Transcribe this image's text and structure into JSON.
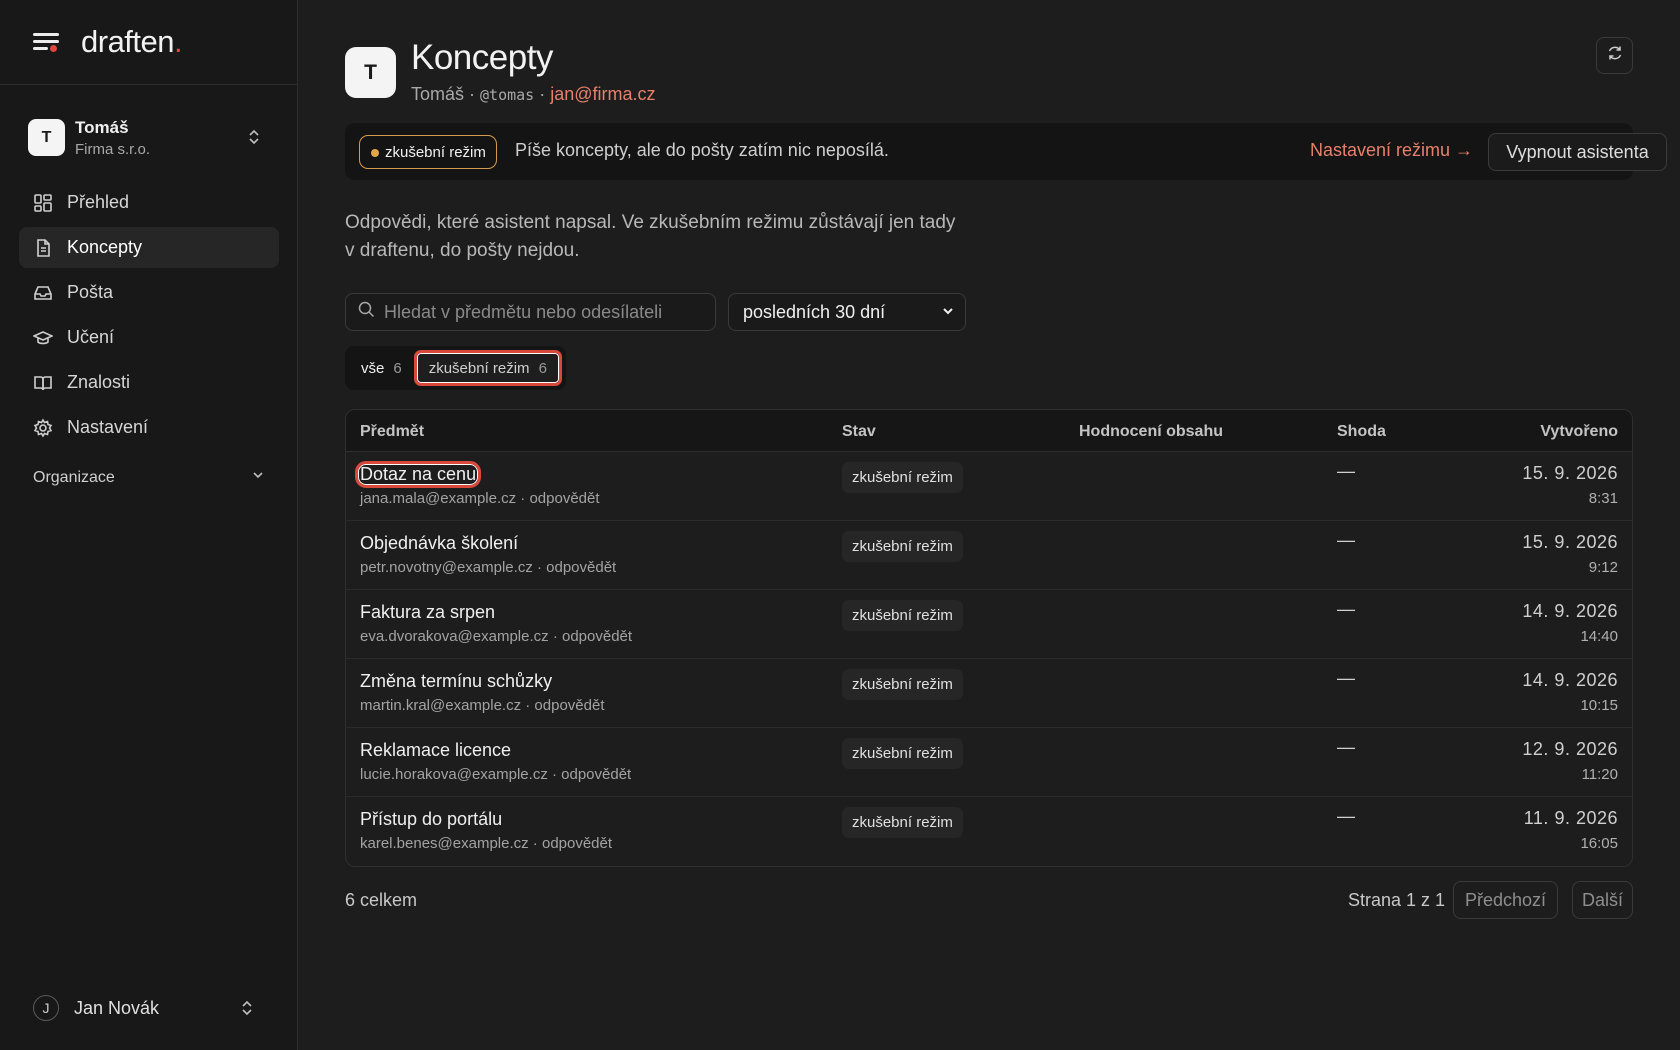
{
  "app": {
    "logo": "draften",
    "logo_dot": "."
  },
  "account": {
    "initial": "T",
    "name": "Tomáš",
    "org": "Firma s.r.o."
  },
  "nav": [
    {
      "label": "Přehled",
      "icon": "grid-icon"
    },
    {
      "label": "Koncepty",
      "icon": "document-icon",
      "active": true
    },
    {
      "label": "Pošta",
      "icon": "inbox-icon"
    },
    {
      "label": "Učení",
      "icon": "graduation-cap-icon"
    },
    {
      "label": "Znalosti",
      "icon": "book-icon"
    },
    {
      "label": "Nastavení",
      "icon": "gear-icon"
    }
  ],
  "organization_label": "Organizace",
  "user": {
    "initial": "J",
    "name": "Jan Novák"
  },
  "header": {
    "initial": "T",
    "title": "Koncepty",
    "sub_name": "Tomáš · ",
    "sub_handle": "@tomas",
    "sub_sep": " · ",
    "sub_email": "jan@firma.cz"
  },
  "banner": {
    "mode_label": "zkušební režim",
    "text": "Píše koncepty, ale do pošty zatím nic neposílá.",
    "settings_link": "Nastavení režimu →",
    "disable_button": "Vypnout asistenta",
    "accent": "#e2a74b"
  },
  "description": "Odpovědi, které asistent napsal. Ve zkušebním režimu zůstávají jen tady v draftenu, do pošty nejdou.",
  "search": {
    "placeholder": "Hledat v předmětu nebo odesílateli",
    "value": ""
  },
  "period": {
    "selected": "posledních 30 dní"
  },
  "tabs": [
    {
      "label": "vše",
      "count": "6"
    },
    {
      "label": "zkušební režim",
      "count": "6"
    }
  ],
  "table": {
    "columns": [
      "Předmět",
      "Stav",
      "Hodnocení obsahu",
      "Shoda",
      "Vytvořeno"
    ],
    "rows": [
      {
        "subject": "Dotaz na cenu",
        "meta": "jana.mala@example.cz · odpovědět",
        "status": "zkušební režim",
        "match": "—",
        "date": "15. 9. 2026",
        "time": "8:31"
      },
      {
        "subject": "Objednávka školení",
        "meta": "petr.novotny@example.cz · odpovědět",
        "status": "zkušební režim",
        "match": "—",
        "date": "15. 9. 2026",
        "time": "9:12"
      },
      {
        "subject": "Faktura za srpen",
        "meta": "eva.dvorakova@example.cz · odpovědět",
        "status": "zkušební režim",
        "match": "—",
        "date": "14. 9. 2026",
        "time": "14:40"
      },
      {
        "subject": "Změna termínu schůzky",
        "meta": "martin.kral@example.cz · odpovědět",
        "status": "zkušební režim",
        "match": "—",
        "date": "14. 9. 2026",
        "time": "10:15"
      },
      {
        "subject": "Reklamace licence",
        "meta": "lucie.horakova@example.cz · odpovědět",
        "status": "zkušební režim",
        "match": "—",
        "date": "12. 9. 2026",
        "time": "11:20"
      },
      {
        "subject": "Přístup do portálu",
        "meta": "karel.benes@example.cz · odpovědět",
        "status": "zkušební režim",
        "match": "—",
        "date": "11. 9. 2026",
        "time": "16:05"
      }
    ]
  },
  "footer": {
    "total": "6 celkem",
    "page_info": "Strana 1 z 1",
    "prev": "Předchozí",
    "next": "Další"
  }
}
